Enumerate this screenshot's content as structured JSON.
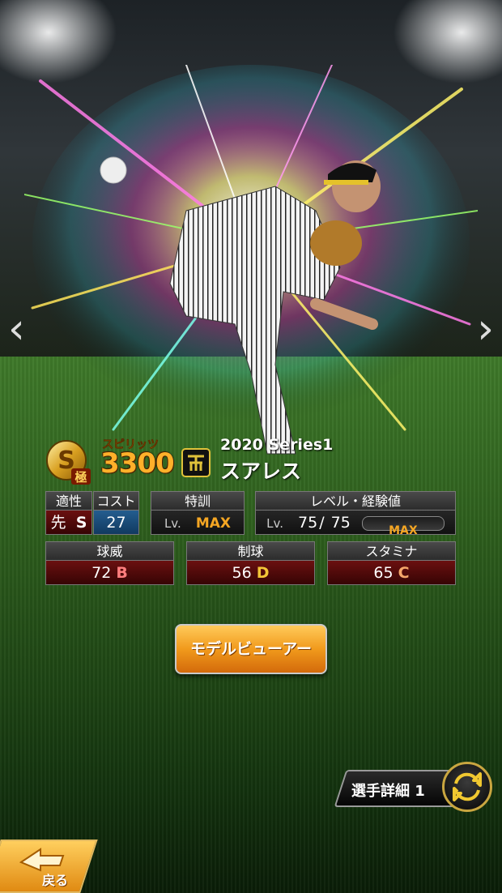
{
  "card": {
    "spirits_label": "スピリッツ",
    "spirits_value": "3300",
    "rank_grade": "S",
    "rank_tier": "極",
    "series": "2020 Series1",
    "name": "スアレス"
  },
  "stats": {
    "aptitude": {
      "label": "適性",
      "position": "先",
      "grade": "S"
    },
    "cost": {
      "label": "コスト",
      "value": "27"
    },
    "special_training": {
      "label": "特訓",
      "lv_prefix": "Lv.",
      "value": "MAX"
    },
    "level_exp": {
      "label": "レベル・経験値",
      "lv_prefix": "Lv.",
      "current": "75",
      "separator": "/",
      "max": "75",
      "bar_text": "MAX",
      "exp_fraction": 1.0
    },
    "velocity": {
      "label": "球威",
      "value": "72",
      "grade": "B"
    },
    "control": {
      "label": "制球",
      "value": "56",
      "grade": "D"
    },
    "stamina": {
      "label": "スタミナ",
      "value": "65",
      "grade": "C"
    }
  },
  "buttons": {
    "model_viewer": "モデルビューアー",
    "player_detail": "選手詳細 1",
    "back": "戻る"
  },
  "nav": {
    "prev": "‹",
    "next": "›"
  },
  "colors": {
    "accent_orange": "#f19a1c",
    "stat_red": "#6b1010",
    "cost_blue": "#245d8f",
    "max_yellow": "#f5a623"
  }
}
